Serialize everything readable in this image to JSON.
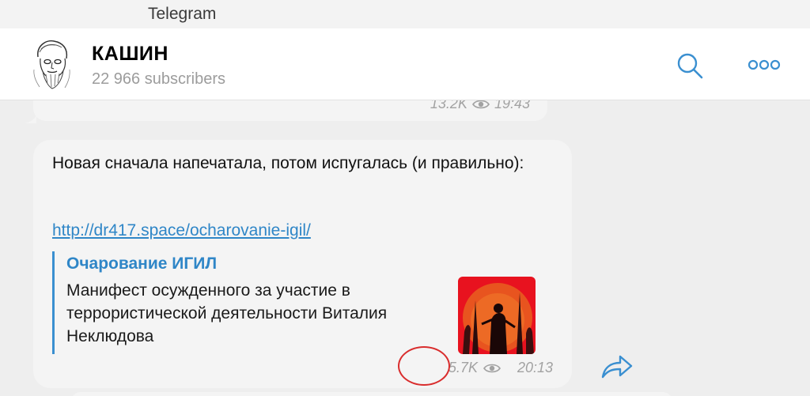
{
  "window": {
    "app_title": "Telegram"
  },
  "header": {
    "channel_name": "КАШИН",
    "subscribers": "22 966 subscribers",
    "icons": {
      "avatar": "avatar-portrait-sketch",
      "search": "search-icon",
      "more": "more-dots-icon"
    }
  },
  "previous_message": {
    "views": "13.2K",
    "time": "19:43"
  },
  "message": {
    "text": "Новая сначала напечатала, потом испугалась (и правильно):",
    "link": "http://dr417.space/ocharovanie-igil/",
    "preview": {
      "title": "Очарование ИГИЛ",
      "description": "Манифест осужденного за участие в террористической деятельности Виталия Неклюдова"
    },
    "views": "5.7K",
    "time": "20:13"
  },
  "colors": {
    "accent": "#2f86c7",
    "icon_blue": "#3a8fd0",
    "highlight_red": "#d92d2d",
    "meta_gray": "#a2a2a2"
  }
}
